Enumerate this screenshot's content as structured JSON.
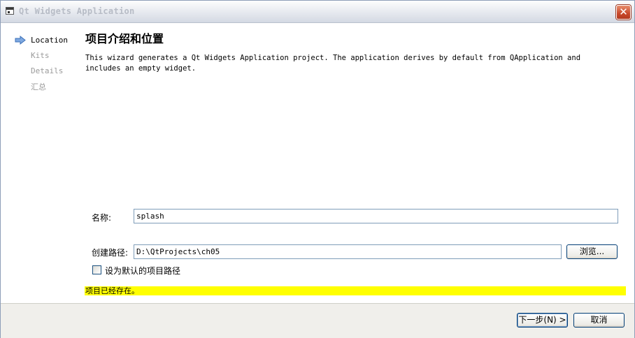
{
  "window": {
    "title": "Qt Widgets Application",
    "close_glyph": "✕"
  },
  "steps": [
    {
      "label": "Location",
      "active": true
    },
    {
      "label": "Kits",
      "active": false
    },
    {
      "label": "Details",
      "active": false
    },
    {
      "label": "汇总",
      "active": false
    }
  ],
  "page": {
    "heading": "项目介绍和位置",
    "description": "This wizard generates a Qt Widgets Application project. The application derives by default from QApplication and includes an empty widget."
  },
  "form": {
    "name_label": "名称:",
    "name_value": "splash",
    "path_label": "创建路径:",
    "path_value": "D:\\QtProjects\\ch05",
    "browse_label": "浏览...",
    "default_path_checkbox_label": "设为默认的项目路径",
    "default_path_checked": false
  },
  "status": {
    "warning": "项目已经存在。",
    "warning_color": "#ffff00"
  },
  "footer": {
    "next_label": "下一步(N) >",
    "cancel_label": "取消"
  },
  "icons": {
    "step_arrow": "arrow-right-icon",
    "app": "window-icon",
    "close": "close-icon"
  }
}
